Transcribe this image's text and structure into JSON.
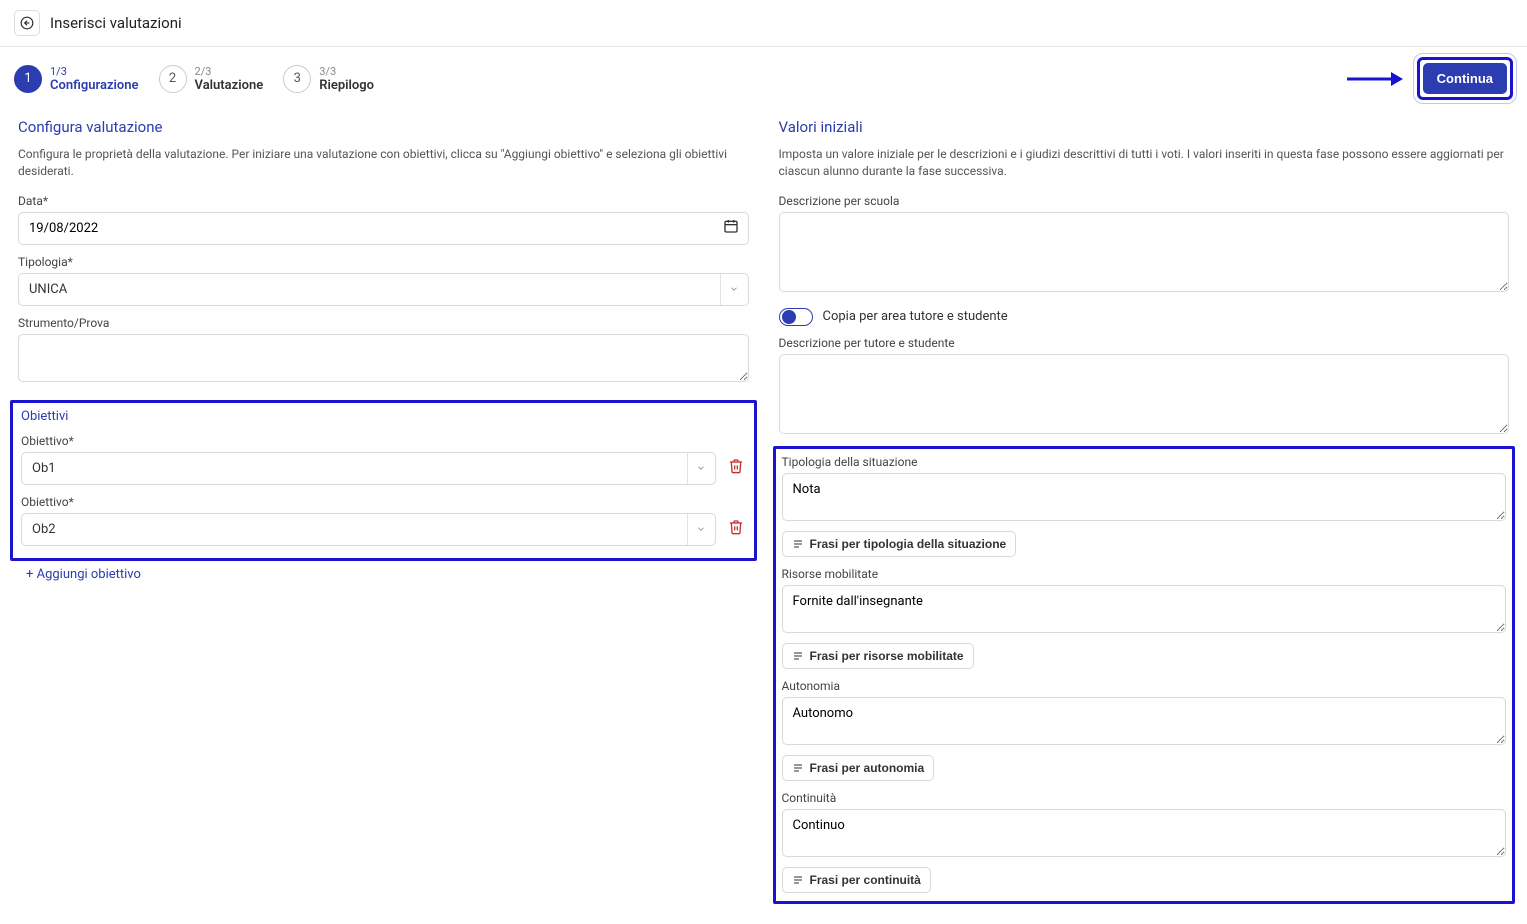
{
  "header": {
    "page_title": "Inserisci valutazioni"
  },
  "steps": {
    "s1": {
      "num": "1",
      "frac": "1/3",
      "label": "Configurazione"
    },
    "s2": {
      "num": "2",
      "frac": "2/3",
      "label": "Valutazione"
    },
    "s3": {
      "num": "3",
      "frac": "3/3",
      "label": "Riepilogo"
    }
  },
  "actions": {
    "continue": "Continua"
  },
  "left": {
    "section_title": "Configura valutazione",
    "section_desc": "Configura le proprietà della valutazione. Per iniziare una valutazione con obiettivi, clicca su \"Aggiungi obiettivo\" e seleziona gli obiettivi desiderati.",
    "date_label": "Data*",
    "date_value": "19/08/2022",
    "type_label": "Tipologia*",
    "type_value": "UNICA",
    "tool_label": "Strumento/Prova",
    "objectives_title": "Obiettivi",
    "objective_label": "Obiettivo*",
    "objectives": [
      "Ob1",
      "Ob2"
    ],
    "add_objective": "+ Aggiungi obiettivo"
  },
  "right": {
    "section_title": "Valori iniziali",
    "section_desc": "Imposta un valore iniziale per le descrizioni e i giudizi descrittivi di tutti i voti. I valori inseriti in questa fase possono essere aggiornati per ciascun alunno durante la fase successiva.",
    "desc_school_label": "Descrizione per scuola",
    "copy_toggle_label": "Copia per area tutore e studente",
    "desc_tutor_label": "Descrizione per tutore e studente",
    "situation_label": "Tipologia della situazione",
    "situation_value": "Nota",
    "situation_btn": "Frasi per tipologia della situazione",
    "resources_label": "Risorse mobilitate",
    "resources_value": "Fornite dall'insegnante",
    "resources_btn": "Frasi per risorse mobilitate",
    "autonomy_label": "Autonomia",
    "autonomy_value": "Autonomo",
    "autonomy_btn": "Frasi per autonomia",
    "continuity_label": "Continuità",
    "continuity_value": "Continuo",
    "continuity_btn": "Frasi per continuità"
  }
}
